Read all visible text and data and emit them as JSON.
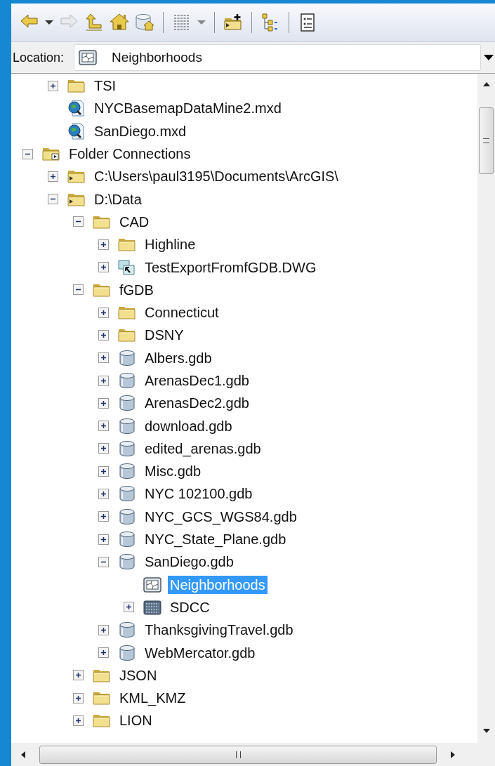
{
  "toolbar": [
    {
      "kind": "back",
      "disabled": false
    },
    {
      "kind": "caret",
      "disabled": false
    },
    {
      "kind": "forward",
      "disabled": true
    },
    {
      "kind": "up",
      "disabled": false
    },
    {
      "kind": "home",
      "disabled": false
    },
    {
      "kind": "catalog-home",
      "disabled": false
    },
    {
      "kind": "separator"
    },
    {
      "kind": "view",
      "disabled": true
    },
    {
      "kind": "caret",
      "disabled": true
    },
    {
      "kind": "separator"
    },
    {
      "kind": "connect-folder",
      "disabled": false
    },
    {
      "kind": "separator"
    },
    {
      "kind": "tree",
      "disabled": false
    },
    {
      "kind": "separator"
    },
    {
      "kind": "details",
      "disabled": false
    }
  ],
  "location": {
    "label": "Location:",
    "value": "Neighborhoods",
    "kind": "feature-class"
  },
  "tree": [
    {
      "children": [
        {
          "label": "TSI",
          "kind": "folder",
          "expanded": false,
          "selected": false
        },
        {
          "label": "NYCBasemapDataMine2.mxd",
          "kind": "mxd",
          "selected": false
        },
        {
          "label": "SanDiego.mxd",
          "kind": "mxd",
          "selected": false
        }
      ]
    },
    {
      "label": "Folder Connections",
      "kind": "folder-connections",
      "expanded": true,
      "selected": false,
      "children": [
        {
          "label": "C:\\Users\\paul3195\\Documents\\ArcGIS\\",
          "kind": "folder-connection",
          "expanded": false,
          "selected": false
        },
        {
          "label": "D:\\Data",
          "kind": "folder-connection",
          "expanded": true,
          "selected": false,
          "children": [
            {
              "label": "CAD",
              "kind": "folder",
              "expanded": true,
              "selected": false,
              "children": [
                {
                  "label": "Highline",
                  "kind": "folder",
                  "expanded": false,
                  "selected": false
                },
                {
                  "label": "TestExportFromfGDB.DWG",
                  "kind": "cad",
                  "expanded": false,
                  "selected": false
                }
              ]
            },
            {
              "label": "fGDB",
              "kind": "folder",
              "expanded": true,
              "selected": false,
              "children": [
                {
                  "label": "Connecticut",
                  "kind": "folder",
                  "expanded": false,
                  "selected": false
                },
                {
                  "label": "DSNY",
                  "kind": "folder",
                  "expanded": false,
                  "selected": false
                },
                {
                  "label": "Albers.gdb",
                  "kind": "gdb",
                  "expanded": false,
                  "selected": false
                },
                {
                  "label": "ArenasDec1.gdb",
                  "kind": "gdb",
                  "expanded": false,
                  "selected": false
                },
                {
                  "label": "ArenasDec2.gdb",
                  "kind": "gdb",
                  "expanded": false,
                  "selected": false
                },
                {
                  "label": "download.gdb",
                  "kind": "gdb",
                  "expanded": false,
                  "selected": false
                },
                {
                  "label": "edited_arenas.gdb",
                  "kind": "gdb",
                  "expanded": false,
                  "selected": false
                },
                {
                  "label": "Misc.gdb",
                  "kind": "gdb",
                  "expanded": false,
                  "selected": false
                },
                {
                  "label": "NYC 102100.gdb",
                  "kind": "gdb",
                  "expanded": false,
                  "selected": false
                },
                {
                  "label": "NYC_GCS_WGS84.gdb",
                  "kind": "gdb",
                  "expanded": false,
                  "selected": false
                },
                {
                  "label": "NYC_State_Plane.gdb",
                  "kind": "gdb",
                  "expanded": false,
                  "selected": false
                },
                {
                  "label": "SanDiego.gdb",
                  "kind": "gdb",
                  "expanded": true,
                  "selected": false,
                  "children": [
                    {
                      "label": "Neighborhoods",
                      "kind": "feature-class",
                      "selected": true
                    },
                    {
                      "label": "SDCC",
                      "kind": "raster",
                      "expanded": false,
                      "selected": false
                    }
                  ]
                },
                {
                  "label": "ThanksgivingTravel.gdb",
                  "kind": "gdb",
                  "expanded": false,
                  "selected": false
                },
                {
                  "label": "WebMercator.gdb",
                  "kind": "gdb",
                  "expanded": false,
                  "selected": false
                }
              ]
            },
            {
              "label": "JSON",
              "kind": "folder",
              "expanded": false,
              "selected": false
            },
            {
              "label": "KML_KMZ",
              "kind": "folder",
              "expanded": false,
              "selected": false
            },
            {
              "label": "LION",
              "kind": "folder",
              "expanded": false,
              "selected": false
            }
          ]
        }
      ]
    }
  ]
}
